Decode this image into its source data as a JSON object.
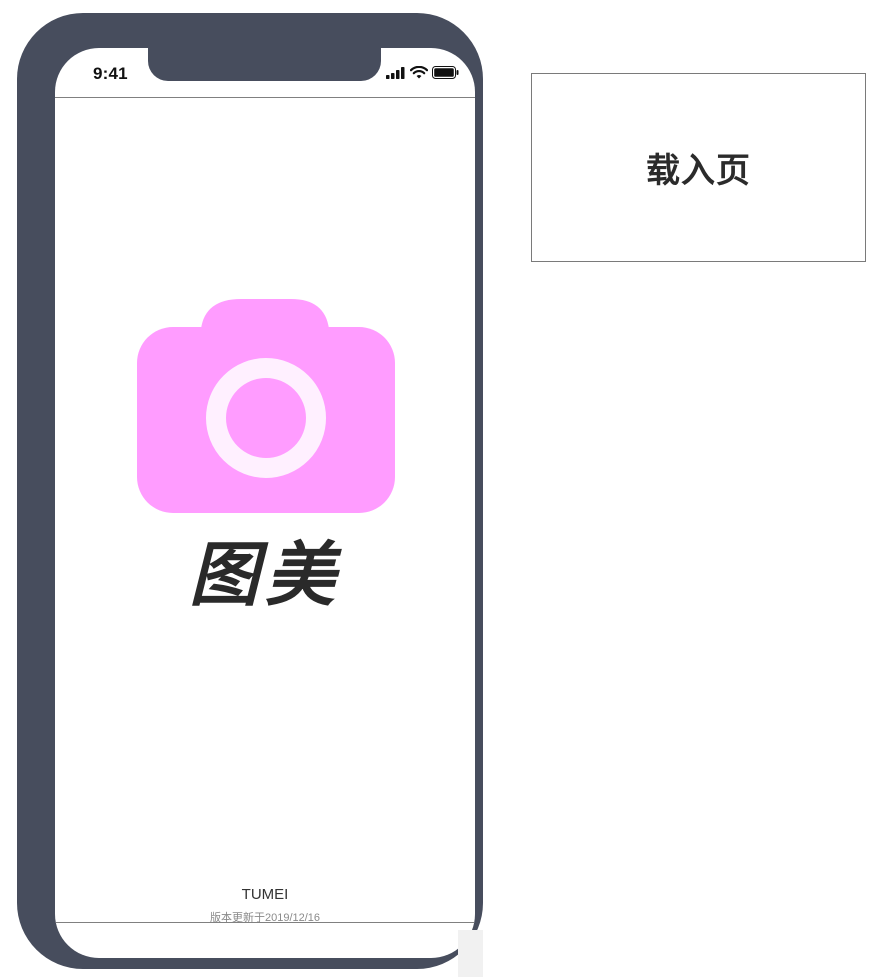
{
  "status_bar": {
    "time": "9:41",
    "icons": [
      "signal-icon",
      "wifi-icon",
      "battery-icon"
    ]
  },
  "app": {
    "icon": "camera-icon",
    "icon_color": "#FF9CFF",
    "name_cn": "图美",
    "brand": "TUMEI",
    "version_text": "版本更新于2019/12/16"
  },
  "annotation": {
    "page_label": "载入页"
  },
  "colors": {
    "phone_frame": "#474D5D",
    "lens_ring": "#FFF0FF"
  }
}
